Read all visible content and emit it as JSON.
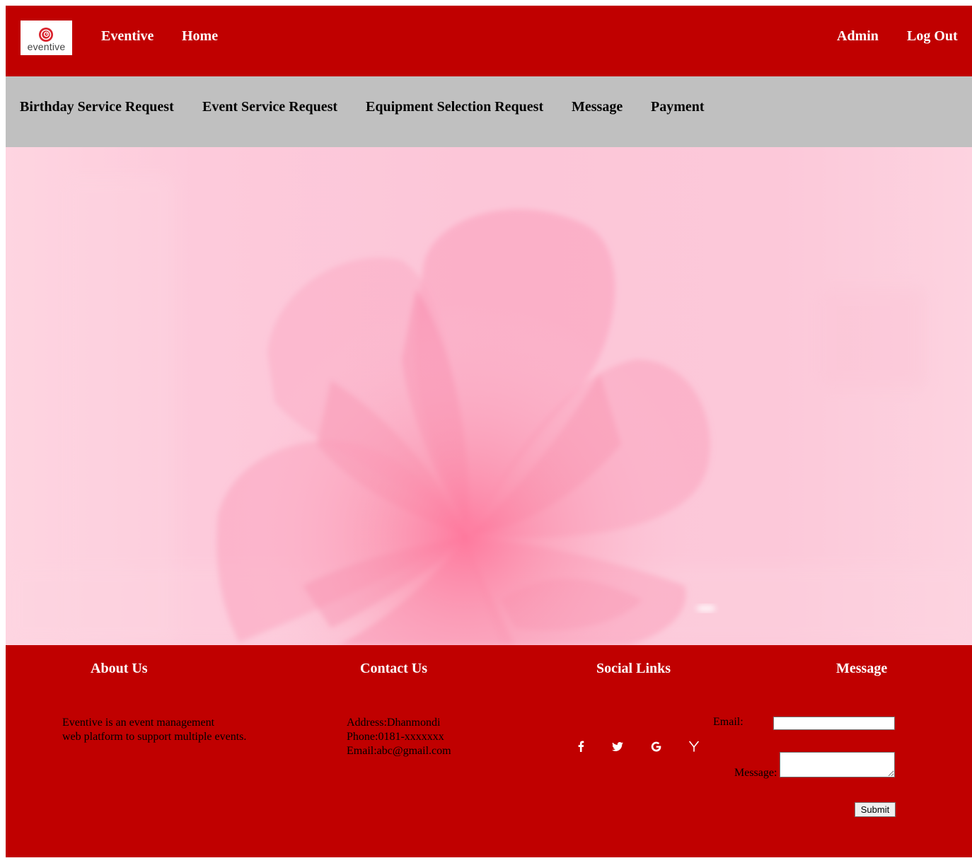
{
  "nav": {
    "logo_text": "eventive",
    "brand": "Eventive",
    "home": "Home",
    "admin": "Admin",
    "logout": "Log Out"
  },
  "subnav": {
    "items": [
      "Birthday Service Request",
      "Event Service Request",
      "Equipment Selection Request",
      "Message",
      "Payment"
    ]
  },
  "footer": {
    "about": {
      "heading": "About Us",
      "line1": "Eventive is an event management",
      "line2": "web platform to support multiple events."
    },
    "contact": {
      "heading": "Contact Us",
      "address": "Address:Dhanmondi",
      "phone": "Phone:0181-xxxxxxx",
      "email": "Email:abc@gmail.com"
    },
    "social": {
      "heading": "Social Links",
      "icons": [
        "facebook-icon",
        "twitter-icon",
        "google-icon",
        "hacker-news-icon"
      ]
    },
    "message": {
      "heading": "Message",
      "email_label": "Email:",
      "message_label": "Message:",
      "submit_label": "Submit"
    }
  },
  "colors": {
    "primary_red": "#c00000",
    "subnav_grey": "#c0c0c0",
    "hero_pink": "#fcc8d9"
  }
}
